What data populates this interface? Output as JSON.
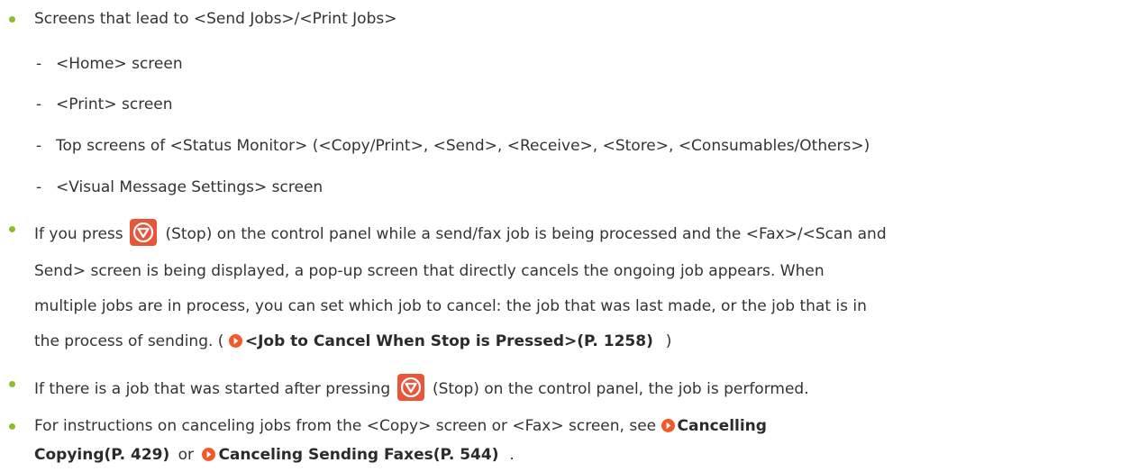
{
  "colors": {
    "bullet": "#8dbd2d",
    "stop_icon": "#e8563a",
    "link_icon": "#f05a2b",
    "text": "#333333"
  },
  "items": {
    "b1": "Screens that lead to <Send Jobs>/<Print Jobs>",
    "s1": "<Home> screen",
    "s2": "<Print> screen",
    "s3": "Top screens of <Status Monitor> (<Copy/Print>, <Send>, <Receive>, <Store>, <Consumables/Others>)",
    "s4": "<Visual Message Settings> screen",
    "dash": "-",
    "b2_l1_pre": "If you press",
    "b2_l1_post": "(Stop) on the control panel while a send/fax job is being processed and the <Fax>/<Scan and",
    "b2_l2": "Send> screen is being displayed, a pop-up screen that directly cancels the ongoing job appears. When",
    "b2_l3": "multiple jobs are in process, you can set which job to cancel: the job that was last made, or the job that is in",
    "b2_l4_pre": "the process of sending. (",
    "b2_l4_link": "<Job to Cancel When Stop is Pressed>(P. 1258)",
    "b2_l4_post": ")",
    "b3_pre": "If there is a job that was started after pressing",
    "b3_post": "(Stop) on the control panel, the job is performed.",
    "b4_l1_pre": "For instructions on canceling jobs from the <Copy> screen or <Fax> screen, see",
    "b4_l1_link": "Cancelling",
    "b4_l2_link1": "Copying(P. 429)",
    "b4_l2_mid": "or",
    "b4_l2_link2": "Canceling Sending Faxes(P. 544)",
    "b4_l2_end": "."
  },
  "icons": {
    "stop": "stop-icon",
    "link": "link-arrow-icon"
  }
}
